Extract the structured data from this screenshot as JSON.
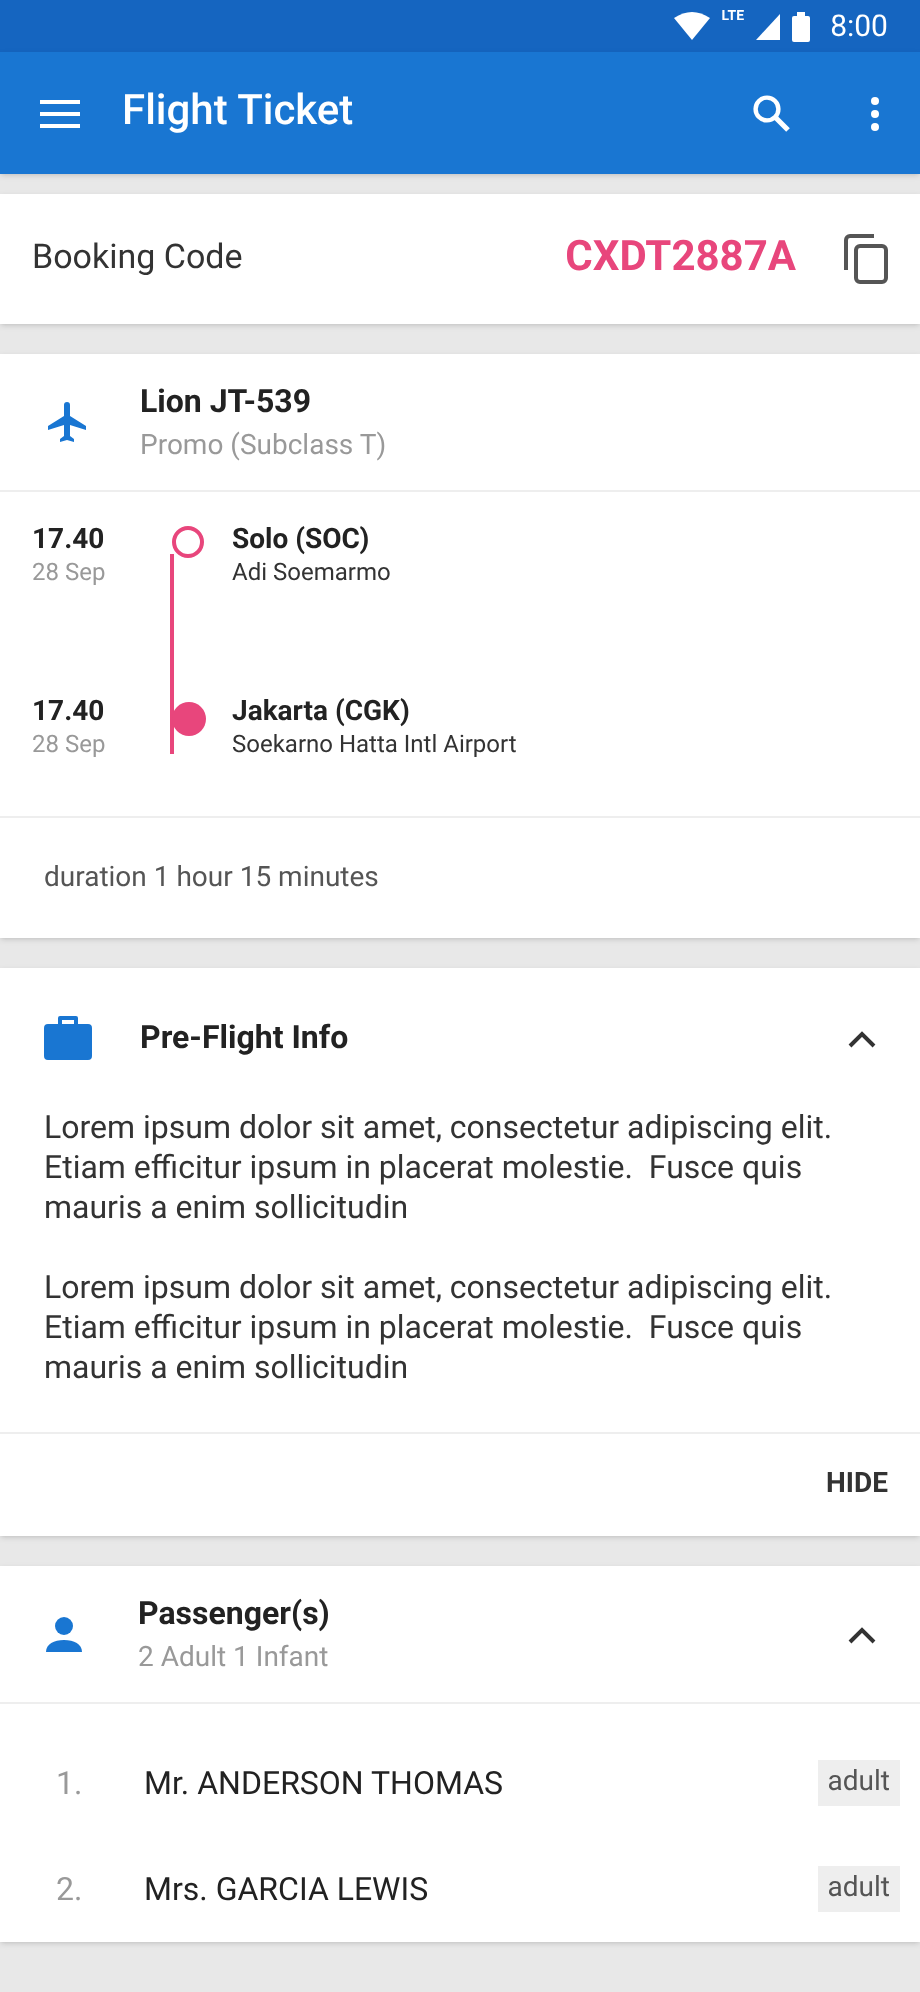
{
  "status_bar": {
    "network": "LTE",
    "time": "8:00"
  },
  "app_bar": {
    "title": "Flight Ticket"
  },
  "booking": {
    "label": "Booking Code",
    "code": "CXDT2887A"
  },
  "flight": {
    "name": "Lion JT-539",
    "class": "Promo (Subclass T)",
    "stops": [
      {
        "kind": "departure",
        "time": "17.40",
        "date": "28 Sep",
        "city": "Solo (SOC)",
        "airport": "Adi Soemarmo"
      },
      {
        "kind": "arrival",
        "time": "17.40",
        "date": "28 Sep",
        "city": "Jakarta (CGK)",
        "airport": "Soekarno Hatta Intl Airport"
      }
    ],
    "duration": "duration 1 hour 15 minutes"
  },
  "pre_flight": {
    "title": "Pre-Flight Info",
    "expanded": true,
    "paragraphs": [
      "Lorem ipsum dolor sit amet, consectetur adipiscing elit. Etiam efficitur ipsum in placerat molestie.  Fusce quis mauris a enim sollicitudin",
      "Lorem ipsum dolor sit amet, consectetur adipiscing elit. Etiam efficitur ipsum in placerat molestie.  Fusce quis mauris a enim sollicitudin"
    ],
    "action": "HIDE"
  },
  "passengers": {
    "title": "Passenger(s)",
    "summary": "2 Adult 1 Infant",
    "expanded": true,
    "rows": [
      {
        "number": "1.",
        "name": "Mr. ANDERSON THOMAS",
        "type": "adult"
      },
      {
        "number": "2.",
        "name": "Mrs. GARCIA LEWIS",
        "type": "adult"
      }
    ]
  }
}
